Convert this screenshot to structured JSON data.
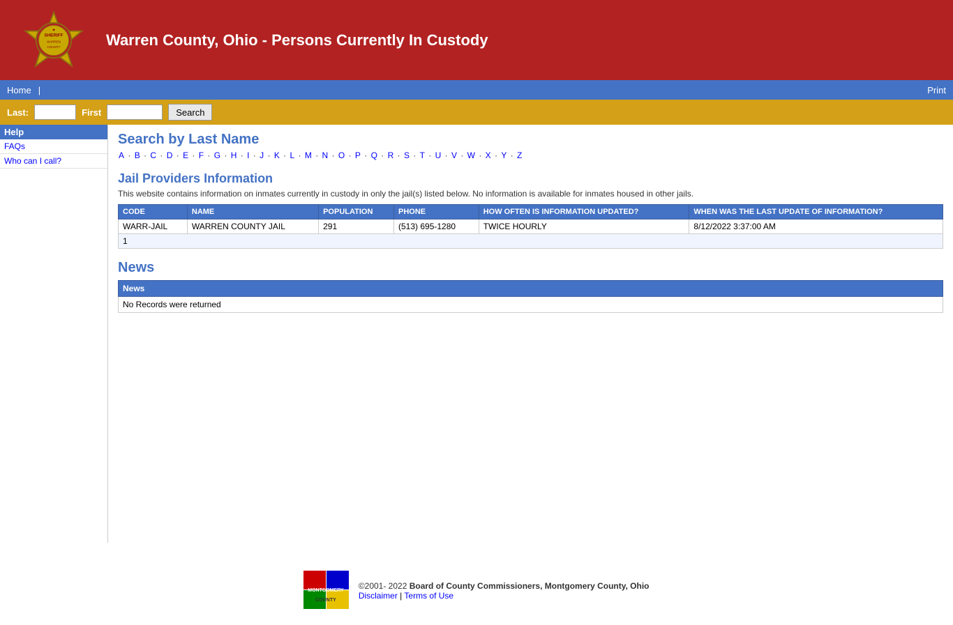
{
  "header": {
    "title": "Warren County, Ohio - Persons Currently In Custody"
  },
  "nav": {
    "home_label": "Home",
    "divider": "|",
    "print_label": "Print"
  },
  "search": {
    "last_label": "Last:",
    "first_label": "First",
    "button_label": "Search",
    "last_placeholder": "",
    "first_placeholder": ""
  },
  "sidebar": {
    "help_label": "Help",
    "items": [
      {
        "label": "FAQs",
        "id": "faqs"
      },
      {
        "label": "Who can I call?",
        "id": "who-can-i-call"
      }
    ]
  },
  "search_section": {
    "title": "Search by Last Name",
    "alphabet": [
      "A",
      "B",
      "C",
      "D",
      "E",
      "F",
      "G",
      "H",
      "I",
      "J",
      "K",
      "L",
      "M",
      "N",
      "O",
      "P",
      "Q",
      "R",
      "S",
      "T",
      "U",
      "V",
      "W",
      "X",
      "Y",
      "Z"
    ]
  },
  "jail_providers": {
    "title": "Jail Providers Information",
    "description": "This website contains information on inmates currently in custody in only the jail(s) listed below. No information is available for inmates housed in other jails.",
    "table_headers": [
      "CODE",
      "NAME",
      "POPULATION",
      "PHONE",
      "HOW OFTEN IS INFORMATION UPDATED?",
      "WHEN WAS THE LAST UPDATE OF INFORMATION?"
    ],
    "rows": [
      {
        "code": "WARR-JAIL",
        "name": "WARREN COUNTY JAIL",
        "population": "291",
        "phone": "(513) 695-1280",
        "update_freq": "TWICE HOURLY",
        "last_update": "8/12/2022 3:37:00 AM"
      }
    ],
    "footer_count": "1"
  },
  "news": {
    "title": "News",
    "header": "News",
    "no_records": "No Records were returned"
  },
  "footer": {
    "copyright": "©2001- 2022",
    "org": "Board of County Commissioners, Montgomery County, Ohio",
    "disclaimer_label": "Disclaimer",
    "separator": "|",
    "terms_label": "Terms of Use",
    "logo_text": "MONTGOMERY\nCOUNTY"
  }
}
